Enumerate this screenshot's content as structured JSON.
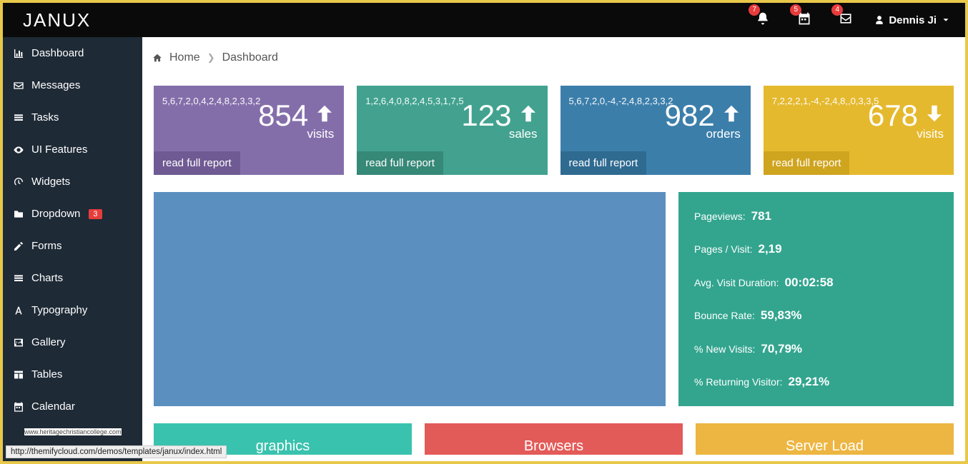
{
  "brand": "JANUX",
  "header": {
    "notifications": [
      {
        "icon": "bell",
        "count": "7"
      },
      {
        "icon": "calendar",
        "count": "5"
      },
      {
        "icon": "inbox",
        "count": "4"
      }
    ],
    "user_name": "Dennis Ji"
  },
  "sidebar": {
    "items": [
      {
        "icon": "bar-chart",
        "label": "Dashboard"
      },
      {
        "icon": "envelope",
        "label": "Messages"
      },
      {
        "icon": "list",
        "label": "Tasks"
      },
      {
        "icon": "eye",
        "label": "UI Features"
      },
      {
        "icon": "dashboard",
        "label": "Widgets"
      },
      {
        "icon": "folder",
        "label": "Dropdown",
        "badge": "3"
      },
      {
        "icon": "edit",
        "label": "Forms"
      },
      {
        "icon": "list-alt",
        "label": "Charts"
      },
      {
        "icon": "font",
        "label": "Typography"
      },
      {
        "icon": "image",
        "label": "Gallery"
      },
      {
        "icon": "table",
        "label": "Tables"
      },
      {
        "icon": "calendar",
        "label": "Calendar"
      }
    ]
  },
  "breadcrumb": {
    "home": "Home",
    "current": "Dashboard"
  },
  "stats": [
    {
      "color": "purple",
      "spark": "5,6,7,2,0,4,2,4,8,2,3,3,2",
      "value": "854",
      "label": "visits",
      "arrow": "up",
      "report": "read full report"
    },
    {
      "color": "teal",
      "spark": "1,2,6,4,0,8,2,4,5,3,1,7,5",
      "value": "123",
      "label": "sales",
      "arrow": "up",
      "report": "read full report"
    },
    {
      "color": "blue",
      "spark": "5,6,7,2,0,-4,-2,4,8,2,3,3,2",
      "value": "982",
      "label": "orders",
      "arrow": "up",
      "report": "read full report"
    },
    {
      "color": "yellow",
      "spark": "7,2,2,2,1,-4,-2,4,8,,0,3,3,5",
      "value": "678",
      "label": "visits",
      "arrow": "down",
      "report": "read full report"
    }
  ],
  "metrics": [
    {
      "label": "Pageviews:",
      "value": "781"
    },
    {
      "label": "Pages / Visit:",
      "value": "2,19"
    },
    {
      "label": "Avg. Visit Duration:",
      "value": "00:02:58"
    },
    {
      "label": "Bounce Rate:",
      "value": "59,83%"
    },
    {
      "label": "% New Visits:",
      "value": "70,79%"
    },
    {
      "label": "% Returning Visitor:",
      "value": "29,21%"
    }
  ],
  "bottom": [
    {
      "color": "teal2",
      "title": "graphics"
    },
    {
      "color": "red",
      "title": "Browsers"
    },
    {
      "color": "gold",
      "title": "Server Load"
    }
  ],
  "credit": "www.heritagechristiancollege.com",
  "statusbar": "http://themifycloud.com/demos/templates/janux/index.html"
}
